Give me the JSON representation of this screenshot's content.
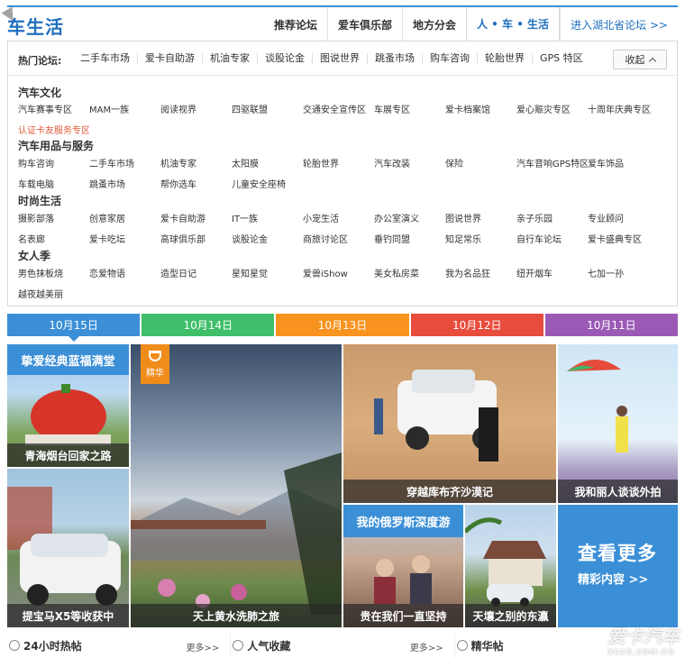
{
  "header": {
    "brand": "车生活",
    "tabs": [
      {
        "label": "推荐论坛",
        "active": false
      },
      {
        "label": "爱车俱乐部",
        "active": false
      },
      {
        "label": "地方分会",
        "active": false
      },
      {
        "label": "人 • 车 • 生活",
        "active": true
      }
    ],
    "enter_link": "进入湖北省论坛 >>"
  },
  "hot": {
    "label": "热门论坛:",
    "items": [
      "二手车市场",
      "爱卡自助游",
      "机油专家",
      "谈股论金",
      "图说世界",
      "跳蚤市场",
      "购车咨询",
      "轮胎世界",
      "GPS 特区"
    ],
    "collapse_label": "收起"
  },
  "categories": [
    {
      "title": "汽车文化",
      "items": [
        "汽车赛事专区",
        "MAM一族",
        "阅读视界",
        "四驱联盟",
        "交通安全宣传区",
        "车展专区",
        "爱卡档案馆",
        "爱心赈灾专区",
        "十周年庆典专区",
        "认证卡友服务专区"
      ]
    },
    {
      "title": "汽车用品与服务",
      "items": [
        "购车咨询",
        "二手车市场",
        "机油专家",
        "太阳膜",
        "轮胎世界",
        "汽车改装",
        "保险",
        "汽车音响GPS特区",
        "爱车饰品",
        "车载电脑",
        "跳蚤市场",
        "帮你选车",
        "儿童安全座椅"
      ]
    },
    {
      "title": "时尚生活",
      "items": [
        "摄影部落",
        "创意家居",
        "爱卡自助游",
        "IT一族",
        "小宠生活",
        "办公室演义",
        "图说世界",
        "亲子乐园",
        "专业顾问",
        "名表廊",
        "爱卡吃坛",
        "高球俱乐部",
        "谈股论金",
        "商旅讨论区",
        "垂钓同盟",
        "知足常乐",
        "自行车论坛",
        "爱卡盛典专区"
      ]
    },
    {
      "title": "女人季",
      "items": [
        "男色抹板烧",
        "恋爱物语",
        "造型日记",
        "星知星觉",
        "爱兽iShow",
        "美女私房菜",
        "我为名品狂",
        "纽开烟车",
        "七加一孙",
        "越夜越美丽"
      ]
    }
  ],
  "dates": [
    {
      "label": "10月15日",
      "color": "#3b8fd6",
      "active": true
    },
    {
      "label": "10月14日",
      "color": "#3fbf6a",
      "active": false
    },
    {
      "label": "10月13日",
      "color": "#f7931e",
      "active": false
    },
    {
      "label": "10月12日",
      "color": "#e84c3d",
      "active": false
    },
    {
      "label": "10月11日",
      "color": "#9b59b6",
      "active": false
    }
  ],
  "tiles": {
    "banner1": "挚爱经典蓝福满堂",
    "qinghai": "青海烟台回家之路",
    "bmw": "提宝马X5等收获中",
    "sky": "天上黄水洗肺之旅",
    "badge": "精华",
    "desert": "穿越库布齐沙漠记",
    "girl": "我和丽人谈谈外拍",
    "banner2": "我的俄罗斯深度游",
    "elders": "贵在我们一直坚持",
    "house": "天壤之别的东瀛",
    "more_big": "查看更多",
    "more_small": "精彩内容 >>"
  },
  "footer": [
    {
      "title": "24小时热帖",
      "more": "更多>>"
    },
    {
      "title": "人气收藏",
      "more": "更多>>"
    },
    {
      "title": "精华帖",
      "more": ""
    }
  ],
  "watermark": {
    "big": "爱卡汽车",
    "small": "XCAR.COM.CN"
  }
}
